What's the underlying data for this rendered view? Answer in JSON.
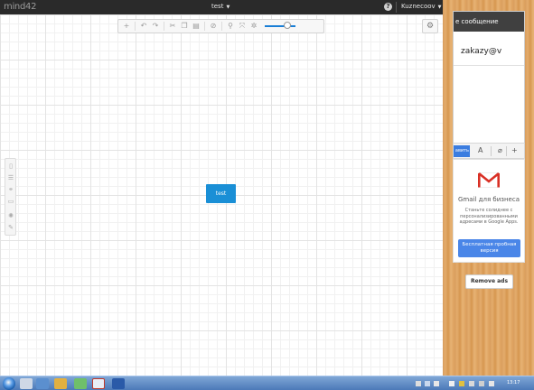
{
  "app": {
    "logo": "mind42",
    "doc_title": "test",
    "user_name": "Kuznecoov"
  },
  "toolbar": {
    "icons": [
      "add-node-icon",
      "undo-icon",
      "redo-icon",
      "cut-icon",
      "copy-icon",
      "paste-icon",
      "delete-icon",
      "search-icon",
      "fit-icon",
      "auto-layout-icon"
    ]
  },
  "side_panel": {
    "icons": [
      "note-icon",
      "list-icon",
      "link-icon",
      "image-icon",
      "sun-icon",
      "paint-icon"
    ]
  },
  "canvas": {
    "node_label": "test"
  },
  "compose": {
    "header": "е сообщение",
    "to_value": "zakazy@v",
    "send_label": "авить"
  },
  "ad": {
    "title": "Gmail для бизнеса",
    "text": "Станьте солиднее с персонализированными адресами в Google Apps.",
    "button_label": "Бесплатная пробная версия"
  },
  "remove_ads_label": "Remove ads",
  "taskbar": {
    "clock": "13:17"
  },
  "colors": {
    "node": "#1a8fd6",
    "topbar": "#2a2a2a",
    "accent": "#4a86e8"
  }
}
